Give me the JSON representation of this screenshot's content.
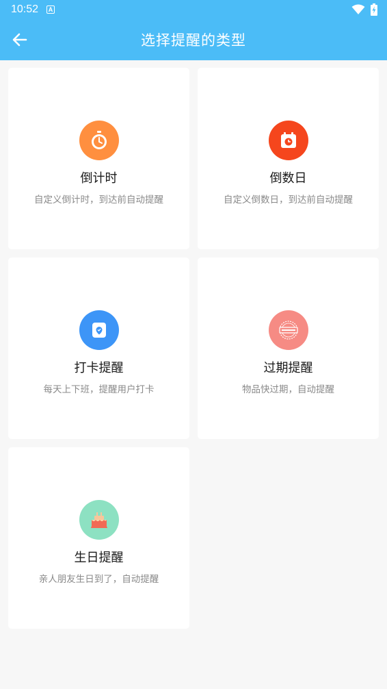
{
  "status_bar": {
    "time": "10:52",
    "notification_glyph": "A"
  },
  "app_bar": {
    "title": "选择提醒的类型",
    "back_icon": "arrow-left-icon"
  },
  "colors": {
    "bar": "#4bbcf7",
    "countdown": "#ff8f3f",
    "days": "#f5461d",
    "checkin": "#3d95f7",
    "expiry": "#f68b84",
    "birthday": "#8de1c2"
  },
  "cards": [
    {
      "title": "倒计时",
      "desc": "自定义倒计时，到达前自动提醒",
      "icon": "stopwatch-icon"
    },
    {
      "title": "倒数日",
      "desc": "自定义倒数日，到达前自动提醒",
      "icon": "calendar-clock-icon"
    },
    {
      "title": "打卡提醒",
      "desc": "每天上下班，提醒用户打卡",
      "icon": "checkin-pin-icon"
    },
    {
      "title": "过期提醒",
      "desc": "物品快过期，自动提醒",
      "icon": "expired-stamp-icon"
    },
    {
      "title": "生日提醒",
      "desc": "亲人朋友生日到了，自动提醒",
      "icon": "birthday-cake-icon"
    }
  ]
}
